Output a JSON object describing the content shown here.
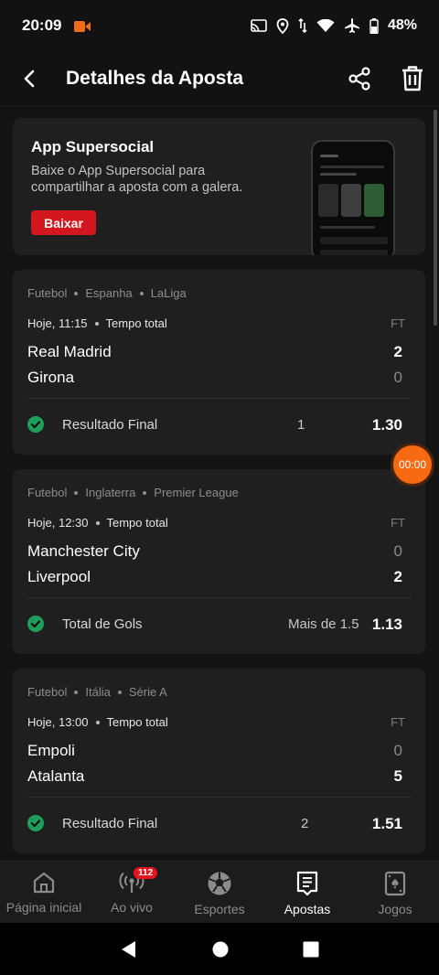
{
  "status_bar": {
    "time": "20:09",
    "battery": "48%"
  },
  "header": {
    "title": "Detalhes da Aposta"
  },
  "promo": {
    "title": "App Supersocial",
    "text": "Baixe o App Supersocial para compartilhar a aposta com a galera.",
    "button": "Baixar"
  },
  "bets": [
    {
      "category": "Futebol",
      "country": "Espanha",
      "league": "LaLiga",
      "when": "Hoje, 11:15",
      "period": "Tempo total",
      "status": "FT",
      "home": "Real Madrid",
      "home_score": "2",
      "away": "Girona",
      "away_score": "0",
      "market": "Resultado Final",
      "selection": "1",
      "odds": "1.30"
    },
    {
      "category": "Futebol",
      "country": "Inglaterra",
      "league": "Premier League",
      "when": "Hoje, 12:30",
      "period": "Tempo total",
      "status": "FT",
      "home": "Manchester City",
      "home_score": "0",
      "away": "Liverpool",
      "away_score": "2",
      "market": "Total de Gols",
      "selection": "Mais de 1.5",
      "odds": "1.13"
    },
    {
      "category": "Futebol",
      "country": "Itália",
      "league": "Série A",
      "when": "Hoje, 13:00",
      "period": "Tempo total",
      "status": "FT",
      "home": "Empoli",
      "home_score": "0",
      "away": "Atalanta",
      "away_score": "5",
      "market": "Resultado Final",
      "selection": "2",
      "odds": "1.51"
    }
  ],
  "timer": "00:00",
  "bottom_nav": {
    "home": "Página inicial",
    "live": "Ao vivo",
    "live_badge": "112",
    "sports": "Esportes",
    "bets": "Apostas",
    "games": "Jogos"
  },
  "colors": {
    "accent": "#d4161e",
    "timer": "#f86a12",
    "success": "#1e9e5a",
    "background": "#141414",
    "card": "#1f1f1f"
  }
}
